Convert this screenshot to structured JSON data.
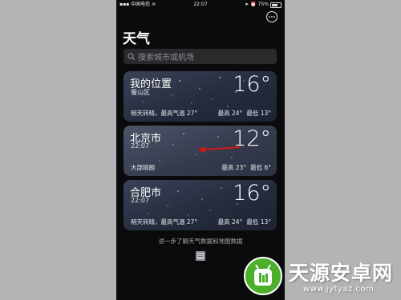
{
  "status_bar": {
    "carrier": "中国电信",
    "time": "22:07",
    "battery": "75%"
  },
  "header": {
    "title": "天气",
    "more_icon": "ellipsis-circle-icon"
  },
  "search": {
    "placeholder": "搜索城市或机场"
  },
  "cities": [
    {
      "name": "我的位置",
      "sub": "蜀山区",
      "temp": "16°",
      "summary": "明天转晴，最高气温 27°",
      "high": "最高 24°",
      "low": "最低 13°"
    },
    {
      "name": "北京市",
      "sub": "22:07",
      "temp": "12°",
      "summary": "大部晴朗",
      "high": "最高 23°",
      "low": "最低 6°"
    },
    {
      "name": "合肥市",
      "sub": "22:07",
      "temp": "16°",
      "summary": "明天转晴，最高气温 27°",
      "high": "最高 24°",
      "low": "最低 13°"
    }
  ],
  "footer": {
    "link": "进一步了解天气数据和地图数据"
  },
  "watermark": {
    "name": "天源安卓网",
    "url": "www.jytyaz.com"
  },
  "colors": {
    "annotation_arrow": "#d01818",
    "watermark_green": "#4caf2a"
  }
}
